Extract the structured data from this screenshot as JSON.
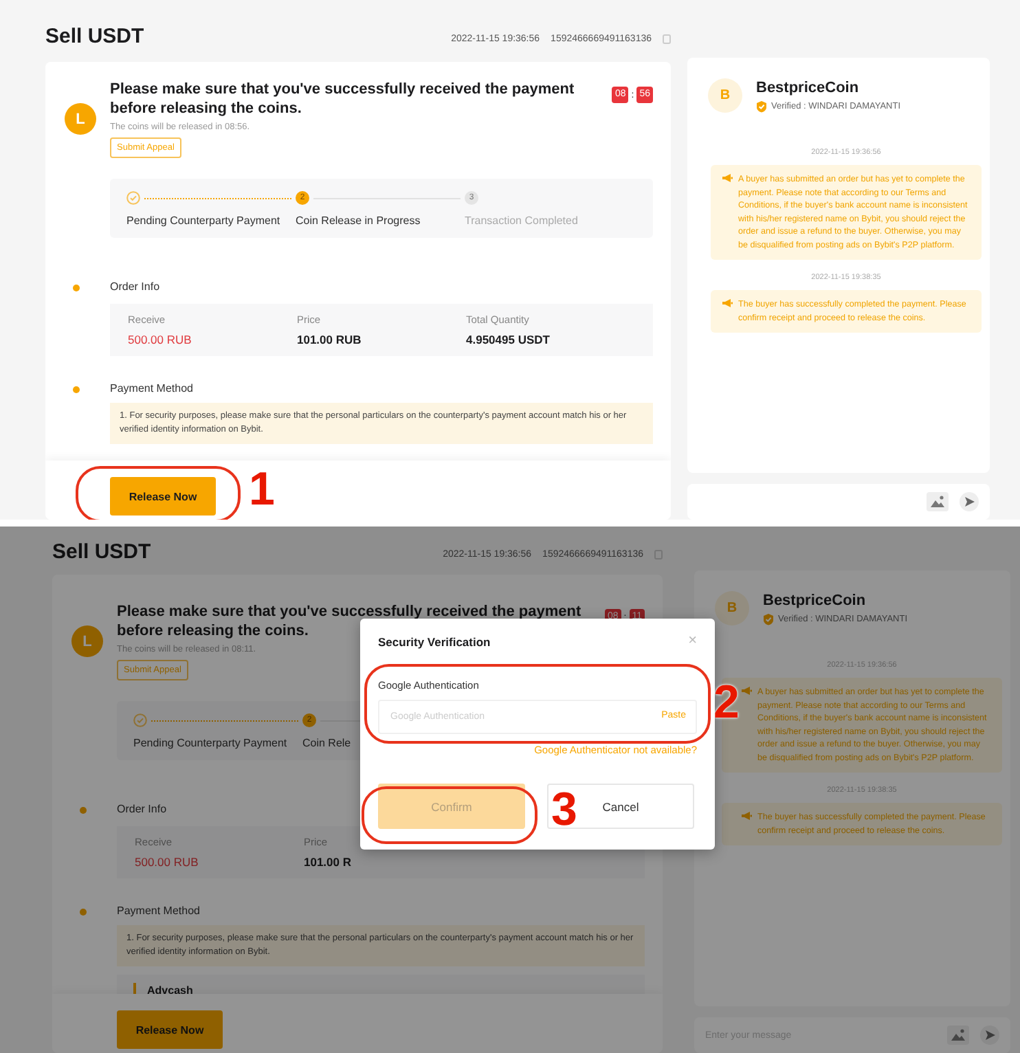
{
  "screens": [
    {
      "header": {
        "title": "Sell USDT",
        "datetime": "2022-11-15 19:36:56",
        "order_id": "1592466669491163136"
      },
      "notice": {
        "avatar": "L",
        "heading": "Please make sure that you've successfully received the payment before releasing the coins.",
        "timer": {
          "minutes": "08",
          "separator": ":",
          "seconds": "56"
        },
        "subtitle": "The coins will be released in 08:56.",
        "appeal_button": "Submit Appeal"
      },
      "steps": [
        {
          "label": "Pending Counterparty Payment",
          "completed": true,
          "active": false
        },
        {
          "number": "2",
          "label": "Coin Release in Progress",
          "completed": false,
          "active": true
        },
        {
          "number": "3",
          "label": "Transaction Completed",
          "completed": false,
          "active": false
        }
      ],
      "order_info": {
        "title": "Order Info",
        "fields": [
          {
            "label": "Receive",
            "value": "500.00 RUB",
            "highlight": true
          },
          {
            "label": "Price",
            "value": "101.00 RUB",
            "highlight": false
          },
          {
            "label": "Total Quantity",
            "value": "4.950495 USDT",
            "highlight": false
          }
        ]
      },
      "payment_method": {
        "title": "Payment Method",
        "note": "1. For security purposes, please make sure that the personal particulars on the counterparty's payment account match his or her verified identity information on Bybit."
      },
      "release_button": "Release Now",
      "chat": {
        "avatar": "B",
        "name": "BestpriceCoin",
        "verified": "Verified : WINDARI DAMAYANTI",
        "messages": [
          {
            "time": "2022-11-15 19:36:56",
            "text": "A buyer has submitted an order but has yet to complete the payment. Please note that according to our Terms and Conditions, if the buyer's bank account name is inconsistent with his/her registered name on Bybit, you should reject the order and issue a refund to the buyer. Otherwise, you may be disqualified from posting ads on Bybit's P2P platform."
          },
          {
            "time": "2022-11-15 19:38:35",
            "text": "The buyer has successfully completed the payment. Please confirm receipt and proceed to release the coins."
          }
        ]
      },
      "annotations": [
        {
          "label": "1"
        }
      ]
    },
    {
      "dimmed": true,
      "header": {
        "title": "Sell USDT",
        "datetime": "2022-11-15 19:36:56",
        "order_id": "1592466669491163136"
      },
      "notice": {
        "avatar": "L",
        "heading": "Please make sure that you've successfully received the payment before releasing the coins.",
        "timer": {
          "minutes": "08",
          "separator": ":",
          "seconds": "11"
        },
        "subtitle": "The coins will be released in 08:11.",
        "appeal_button": "Submit Appeal"
      },
      "steps": [
        {
          "label": "Pending Counterparty Payment",
          "completed": true,
          "active": false
        },
        {
          "number": "2",
          "label": "Coin Rele",
          "completed": false,
          "active": true
        }
      ],
      "order_info": {
        "title": "Order Info",
        "fields": [
          {
            "label": "Receive",
            "value": "500.00 RUB",
            "highlight": true
          },
          {
            "label": "Price",
            "value": "101.00 R",
            "highlight": false
          }
        ]
      },
      "payment_method": {
        "title": "Payment Method",
        "note": "1. For security purposes, please make sure that the personal particulars on the counterparty's payment account match his or her verified identity information on Bybit.",
        "method": "Advcash"
      },
      "release_button": "Release Now",
      "chat": {
        "avatar": "B",
        "name": "BestpriceCoin",
        "verified": "Verified : WINDARI DAMAYANTI",
        "input_placeholder": "Enter your message",
        "messages": [
          {
            "time": "2022-11-15 19:36:56",
            "text": "A buyer has submitted an order but has yet to complete the payment. Please note that according to our Terms and Conditions, if the buyer's bank account name is inconsistent with his/her registered name on Bybit, you should reject the order and issue a refund to the buyer. Otherwise, you may be disqualified from posting ads on Bybit's P2P platform."
          },
          {
            "time": "2022-11-15 19:38:35",
            "text": "The buyer has successfully completed the payment. Please confirm receipt and proceed to release the coins."
          }
        ]
      },
      "modal": {
        "title": "Security Verification",
        "close": "×",
        "field_label": "Google Authentication",
        "placeholder": "Google Authentication",
        "paste": "Paste",
        "help_link": "Google Authenticator not available?",
        "confirm": {
          "label": "Confirm",
          "disabled": true
        },
        "cancel": "Cancel"
      },
      "annotations": [
        {
          "label": "2"
        },
        {
          "label": "3"
        }
      ]
    }
  ]
}
